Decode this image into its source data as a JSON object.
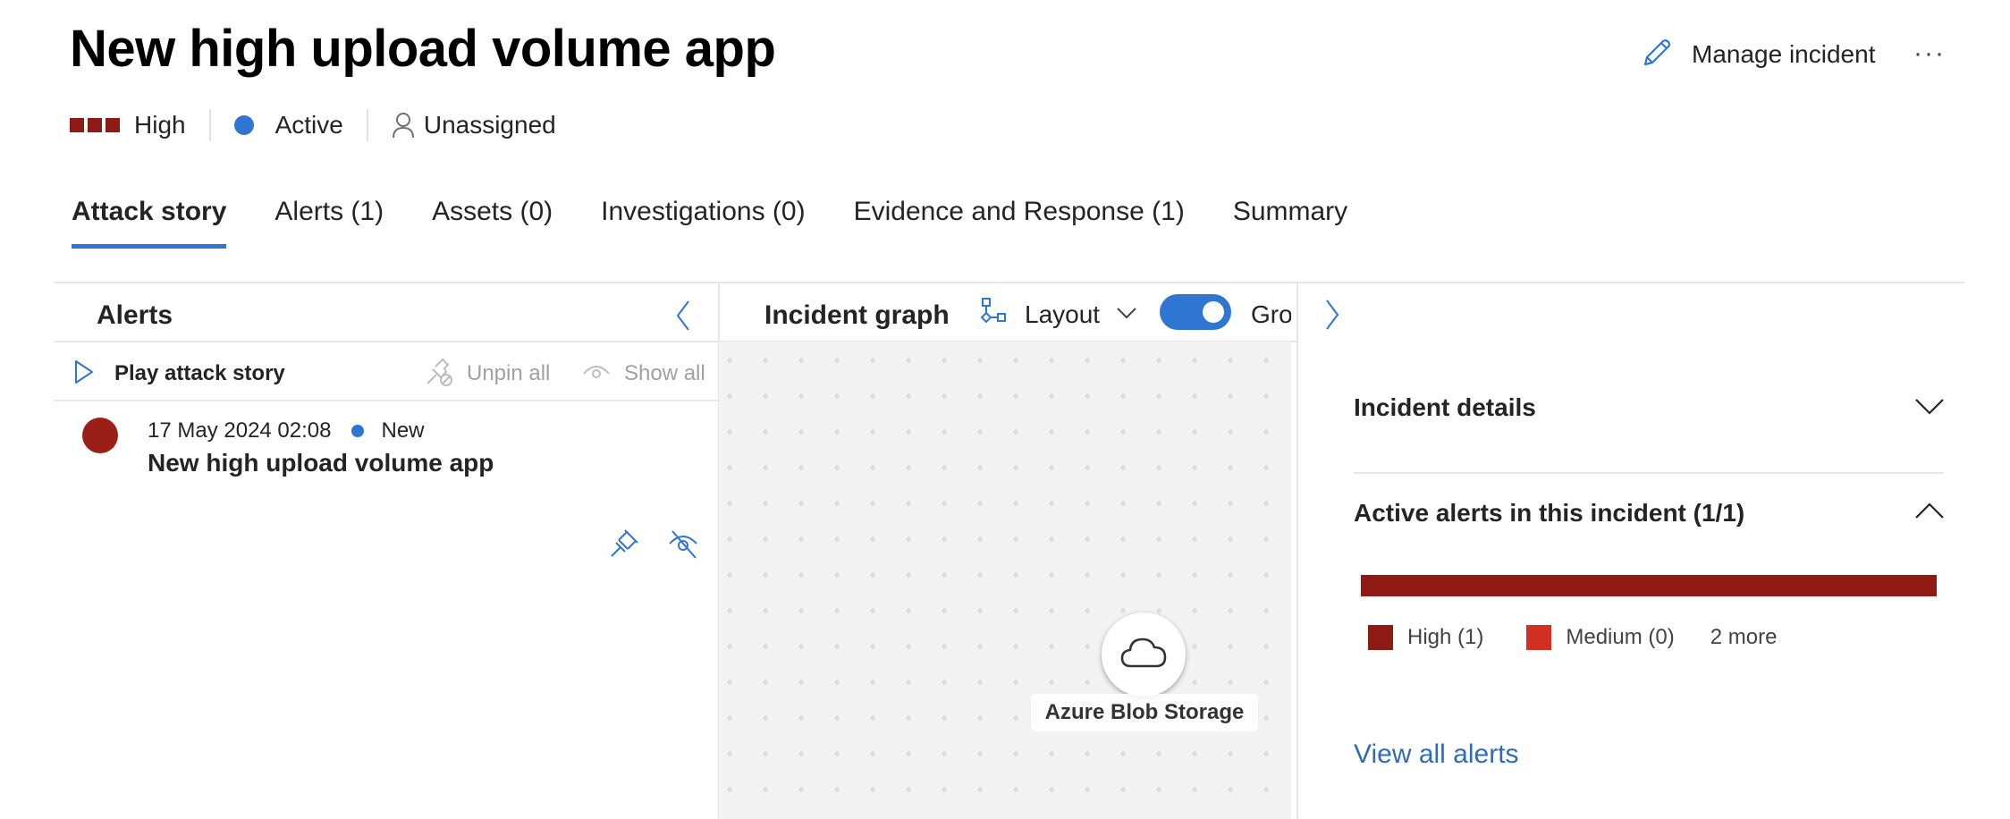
{
  "header": {
    "title": "New high upload volume app",
    "manage_label": "Manage incident",
    "more_label": "···",
    "severity": "High",
    "status": "Active",
    "assignee": "Unassigned"
  },
  "colors": {
    "accent": "#2F76D2",
    "severity_high": "#8E1B13",
    "severity_medium": "#D13023",
    "link": "#2F6CB8"
  },
  "tabs": [
    {
      "label": "Attack story",
      "active": true
    },
    {
      "label": "Alerts (1)"
    },
    {
      "label": "Assets (0)"
    },
    {
      "label": "Investigations (0)"
    },
    {
      "label": "Evidence and Response (1)"
    },
    {
      "label": "Summary"
    }
  ],
  "alerts_panel": {
    "title": "Alerts",
    "play_label": "Play attack story",
    "unpin_label": "Unpin all",
    "show_label": "Show all",
    "items": [
      {
        "timestamp": "17 May 2024 02:08",
        "status": "New",
        "title": "New high upload volume app",
        "severity": "High"
      }
    ]
  },
  "graph_panel": {
    "title": "Incident graph",
    "layout_label": "Layout",
    "group_label": "Grou",
    "group_toggle_on": true,
    "nodes": [
      {
        "label": "Azure Blob Storage",
        "icon": "cloud-icon"
      }
    ]
  },
  "details_panel": {
    "incident_details_label": "Incident details",
    "active_alerts_label": "Active alerts in this incident (1/1)",
    "severity_distribution": {
      "high": 1,
      "medium": 0
    },
    "legend": [
      {
        "label": "High (1)",
        "color": "#8E1B13"
      },
      {
        "label": "Medium (0)",
        "color": "#D13023"
      }
    ],
    "more_label": "2 more",
    "view_all_label": "View all alerts"
  }
}
